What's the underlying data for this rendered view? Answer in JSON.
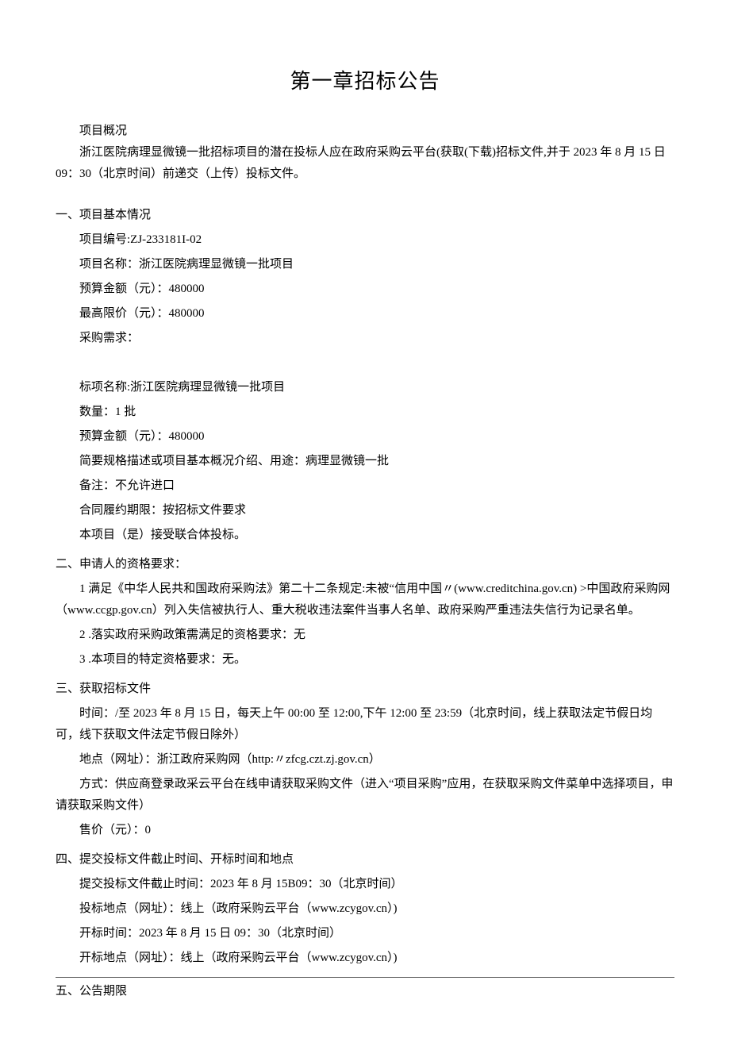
{
  "title": "第一章招标公告",
  "intro": {
    "l1": "项目概况",
    "l2": "浙江医院病理显微镜一批招标项目的潜在投标人应在政府采购云平台(获取(下载)招标文件,并于 2023 年 8 月 15 日 09：30（北京时间）前递交（上传）投标文件。"
  },
  "s1": {
    "title": "一、项目基本情况",
    "l1": "项目编号:ZJ-233181I-02",
    "l2": "项目名称：浙江医院病理显微镜一批项目",
    "l3": "预算金额（元）：480000",
    "l4": "最高限价（元）：480000",
    "l5": "采购需求：",
    "l6": "标项名称:浙江医院病理显微镜一批项目",
    "l7": "数量：1 批",
    "l8": "预算金额（元）：480000",
    "l9": "简要规格描述或项目基本概况介绍、用途：病理显微镜一批",
    "l10": "备注：不允许进口",
    "l11": "合同履约期限：按招标文件要求",
    "l12": "本项目（是）接受联合体投标。"
  },
  "s2": {
    "title": "二、申请人的资格要求：",
    "l1": "1 满足《中华人民共和国政府采购法》第二十二条规定:未被“信用中国〃(www.creditchina.gov.cn) >中国政府采购网（www.ccgp.gov.cn）列入失信被执行人、重大税收违法案件当事人名单、政府采购严重违法失信行为记录名单。",
    "l2": "2 .落实政府采购政策需满足的资格要求：无",
    "l3": "3 .本项目的特定资格要求：无。"
  },
  "s3": {
    "title": "三、获取招标文件",
    "l1": "时间：/至 2023 年 8 月 15 日，每天上午 00:00 至 12:00,下午 12:00 至 23:59（北京时间，线上获取法定节假日均可，线下获取文件法定节假日除外）",
    "l2": "地点（网址）：浙江政府采购网（http:〃zfcg.czt.zj.gov.cn）",
    "l3": "方式：供应商登录政采云平台在线申请获取采购文件（进入“项目采购”应用，在获取采购文件菜单中选择项目，申请获取采购文件）",
    "l4": "售价（元）：0"
  },
  "s4": {
    "title": "四、提交投标文件截止时间、开标时间和地点",
    "l1": "提交投标文件截止时间：2023 年 8 月 15B09：30（北京时间）",
    "l2": "投标地点（网址）：线上（政府采购云平台（www.zcygov.cn）)",
    "l3": "开标时间：2023 年 8 月 15 日 09：30（北京时间）",
    "l4": "开标地点（网址）：线上（政府采购云平台（www.zcygov.cn）)"
  },
  "s5": {
    "title": "五、公告期限"
  }
}
